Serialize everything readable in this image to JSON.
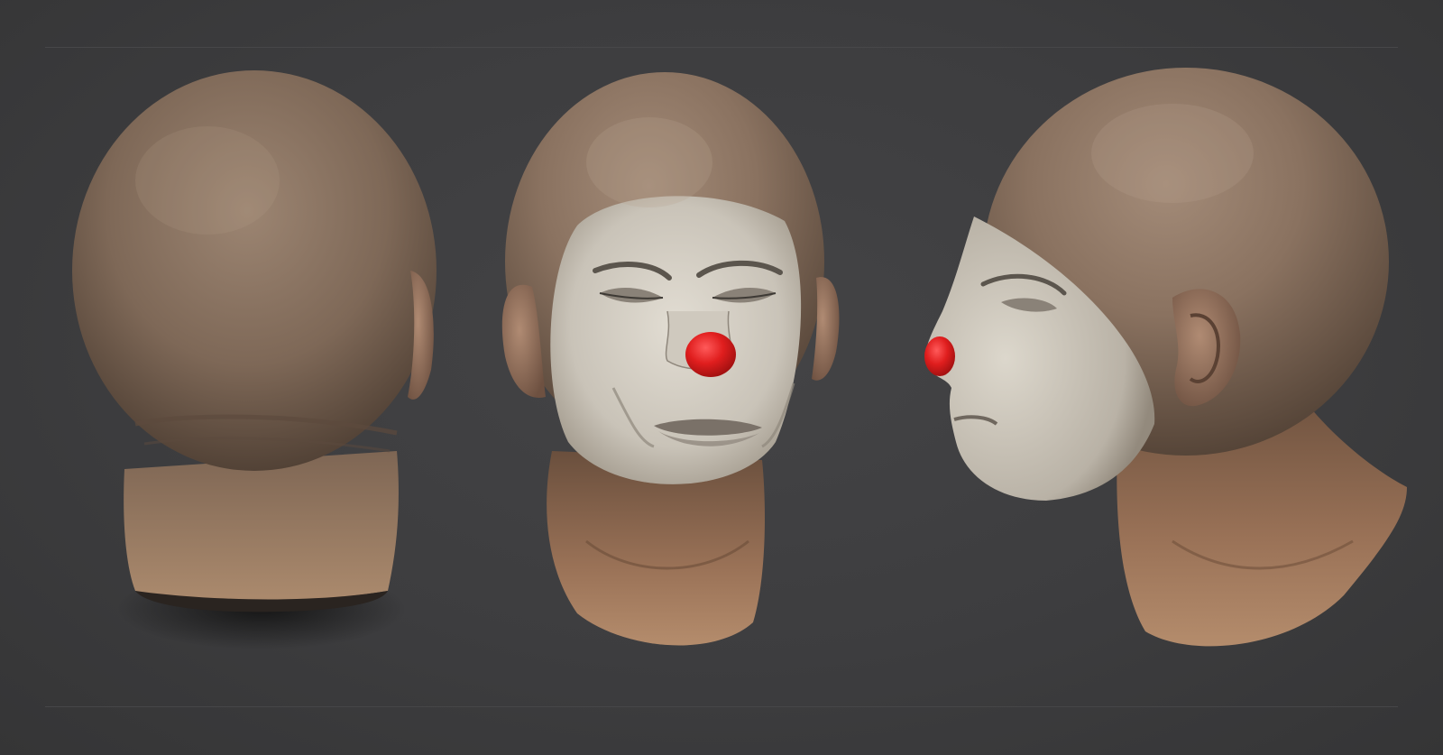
{
  "scene": {
    "background_color": "#3d3d3f",
    "skin_color": "#8d7461",
    "neck_color": "#9a7257",
    "face_paint_color": "#d6d1c7",
    "nose_color": "#e01e1e",
    "views": [
      {
        "view": "back"
      },
      {
        "view": "front"
      },
      {
        "view": "side"
      }
    ]
  }
}
